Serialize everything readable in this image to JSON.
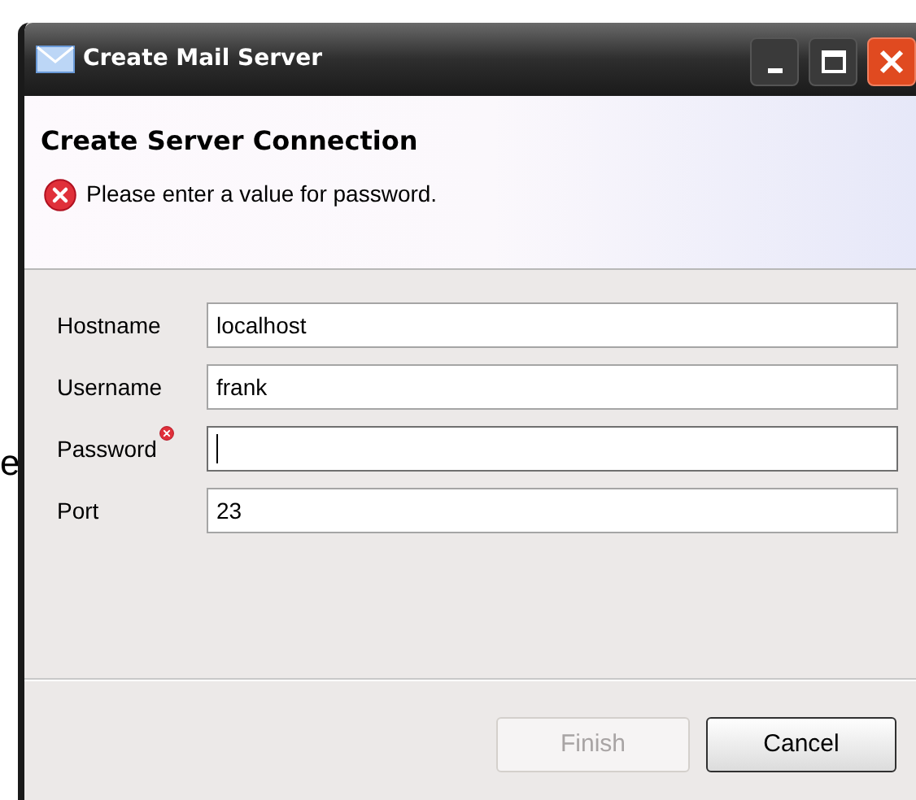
{
  "background_text": "e",
  "window": {
    "title": "Create Mail Server"
  },
  "header": {
    "title": "Create Server Connection",
    "message": "Please enter a value for password."
  },
  "fields": [
    {
      "label": "Hostname",
      "value": "localhost",
      "error": false,
      "focused": false
    },
    {
      "label": "Username",
      "value": "frank",
      "error": false,
      "focused": false
    },
    {
      "label": "Password",
      "error": true,
      "focused": true
    },
    {
      "label": "Port",
      "value": "23",
      "error": false,
      "focused": false
    }
  ],
  "buttons": [
    {
      "label": "Finish",
      "disabled": true
    },
    {
      "label": "Cancel",
      "disabled": false
    }
  ]
}
